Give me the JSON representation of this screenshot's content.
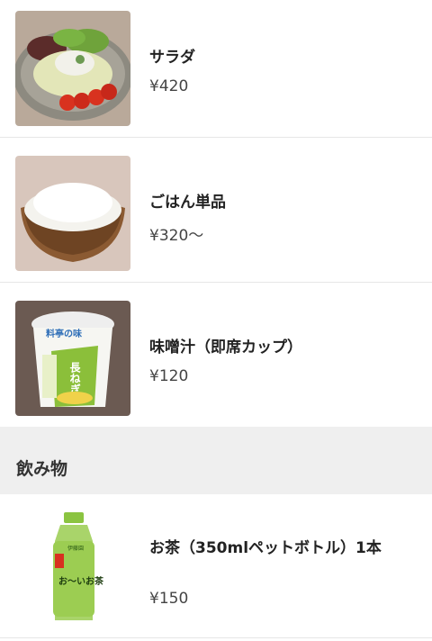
{
  "items": [
    {
      "name": "サラダ",
      "price": "¥420",
      "image": "salad-photo"
    },
    {
      "name": "ごはん単品",
      "price": "¥320〜",
      "image": "rice-bowl-photo"
    },
    {
      "name": "味噌汁（即席カップ）",
      "price": "¥120",
      "image": "miso-soup-cup-photo"
    }
  ],
  "section": {
    "title": "飲み物"
  },
  "drinks": [
    {
      "name": "お茶（350mlペットボトル）1本",
      "price": "¥150",
      "image": "green-tea-bottle-photo"
    }
  ],
  "image_labels": {
    "soup_cup_brand": "料亭の味",
    "soup_cup_flavor": "長ねぎ",
    "tea_brand": "伊藤園",
    "tea_name": "お〜いお茶"
  },
  "colors": {
    "divider": "#e6e6e6",
    "section_bg": "#efefef"
  }
}
